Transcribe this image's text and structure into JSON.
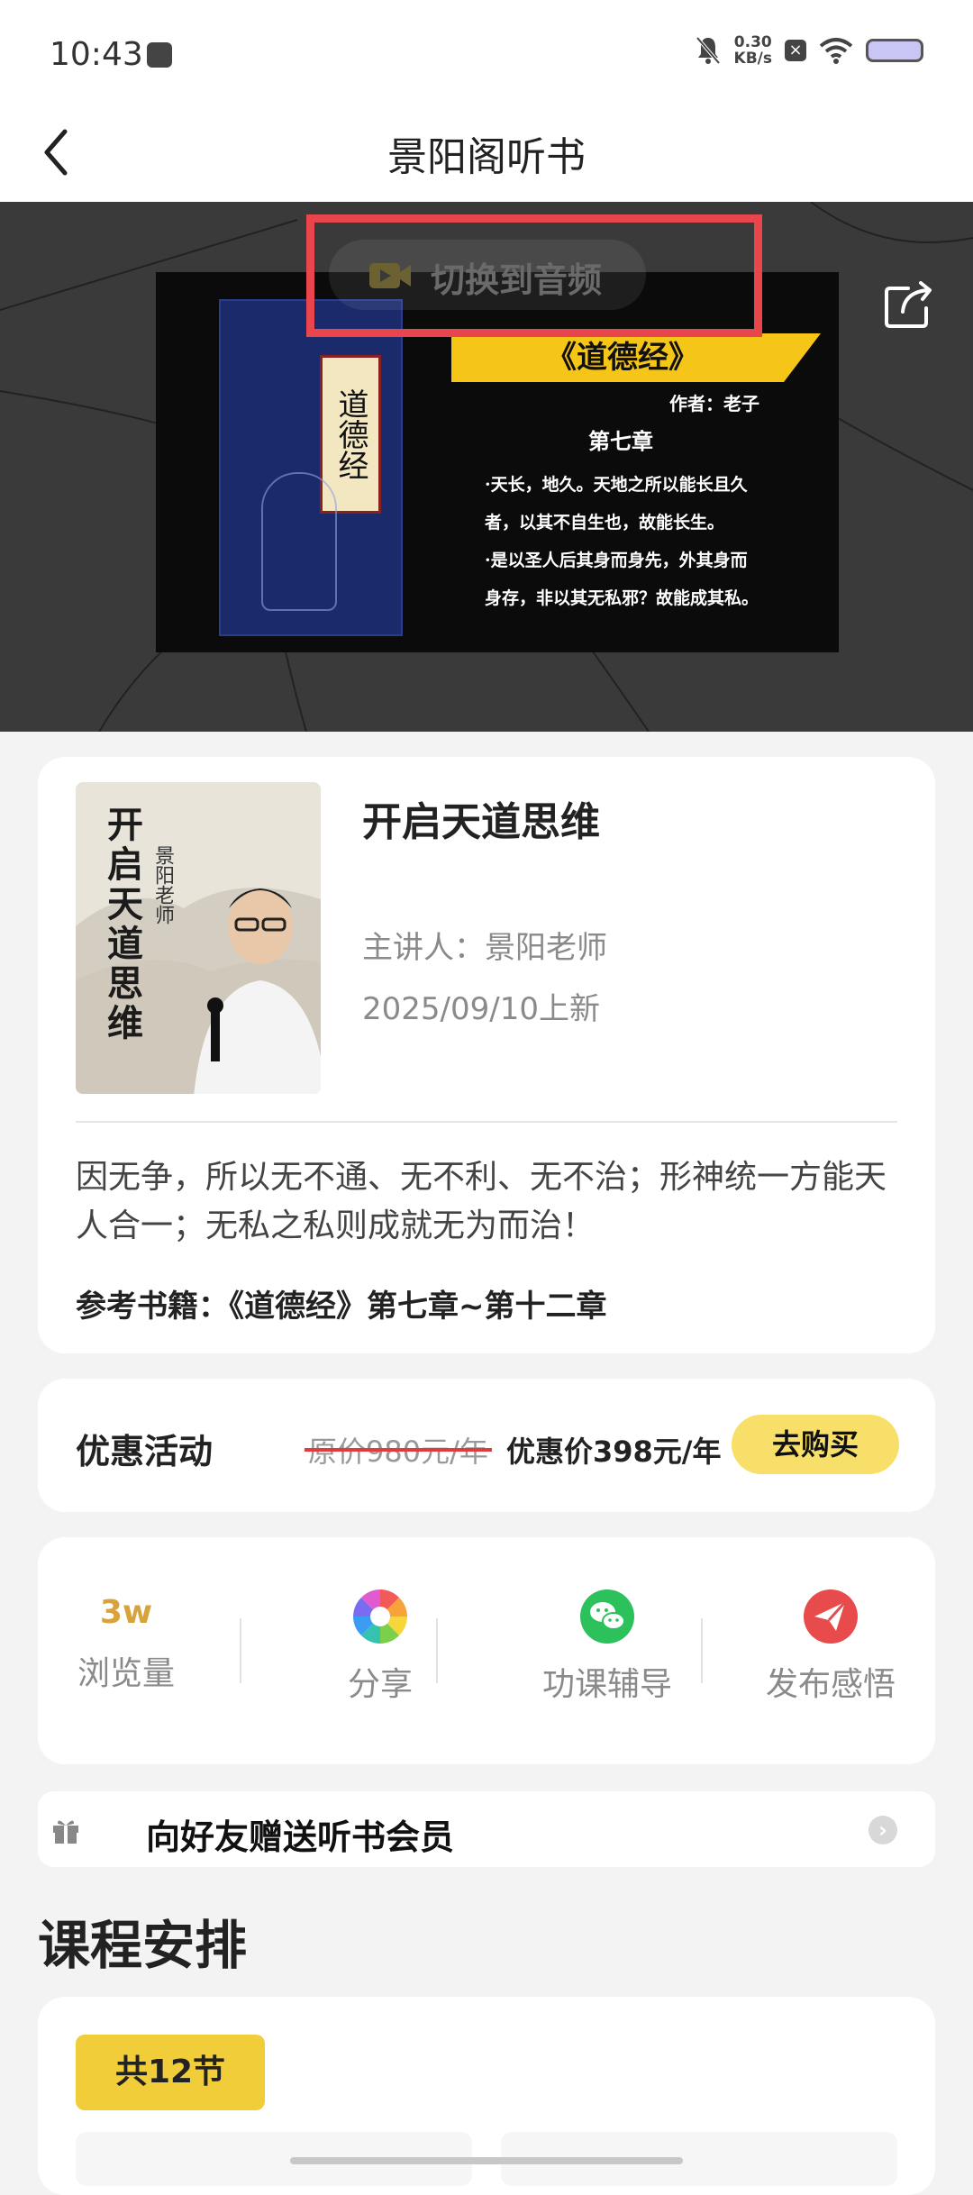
{
  "status_bar": {
    "time": "10:43",
    "speed_value": "0.30",
    "speed_unit": "KB/s"
  },
  "nav": {
    "title": "景阳阁听书"
  },
  "video": {
    "switch_label": "切换到音频",
    "slide": {
      "book_title": "道德经",
      "banner_title": "《道德经》",
      "author": "作者：老子",
      "chapter": "第七章",
      "lines": [
        "·天长，地久。天地之所以能长且久",
        "者，以其不自生也，故能长生。",
        "·是以圣人后其身而身先，外其身而",
        "身存，非以其无私邪？故能成其私。"
      ]
    }
  },
  "course": {
    "cover_title": "开启天道思维",
    "cover_subtitle": "景阳老师",
    "title": "开启天道思维",
    "lecturer": "主讲人：景阳老师",
    "date": "2025/09/10上新",
    "description": "因无争，所以无不通、无不利、无不治；形神统一方能天人合一；无私之私则成就无为而治！",
    "reference": "参考书籍：《道德经》第七章~第十二章"
  },
  "promo": {
    "title": "优惠活动",
    "original_price": "原价980元/年",
    "discount_price": "优惠价398元/年",
    "buy_label": "去购买"
  },
  "stats": {
    "views_value": "3w",
    "views_label": "浏览量",
    "share_label": "分享",
    "tutor_label": "功课辅导",
    "insight_label": "发布感悟"
  },
  "gift": {
    "text": "向好友赠送听书会员"
  },
  "schedule": {
    "title": "课程安排",
    "count": "共12节"
  },
  "colors": {
    "accent_yellow": "#f2cd3a",
    "button_yellow": "#f7df6a",
    "wechat_green": "#2dc15c",
    "send_red": "#e84b4b",
    "highlight_red": "#e8454c"
  }
}
